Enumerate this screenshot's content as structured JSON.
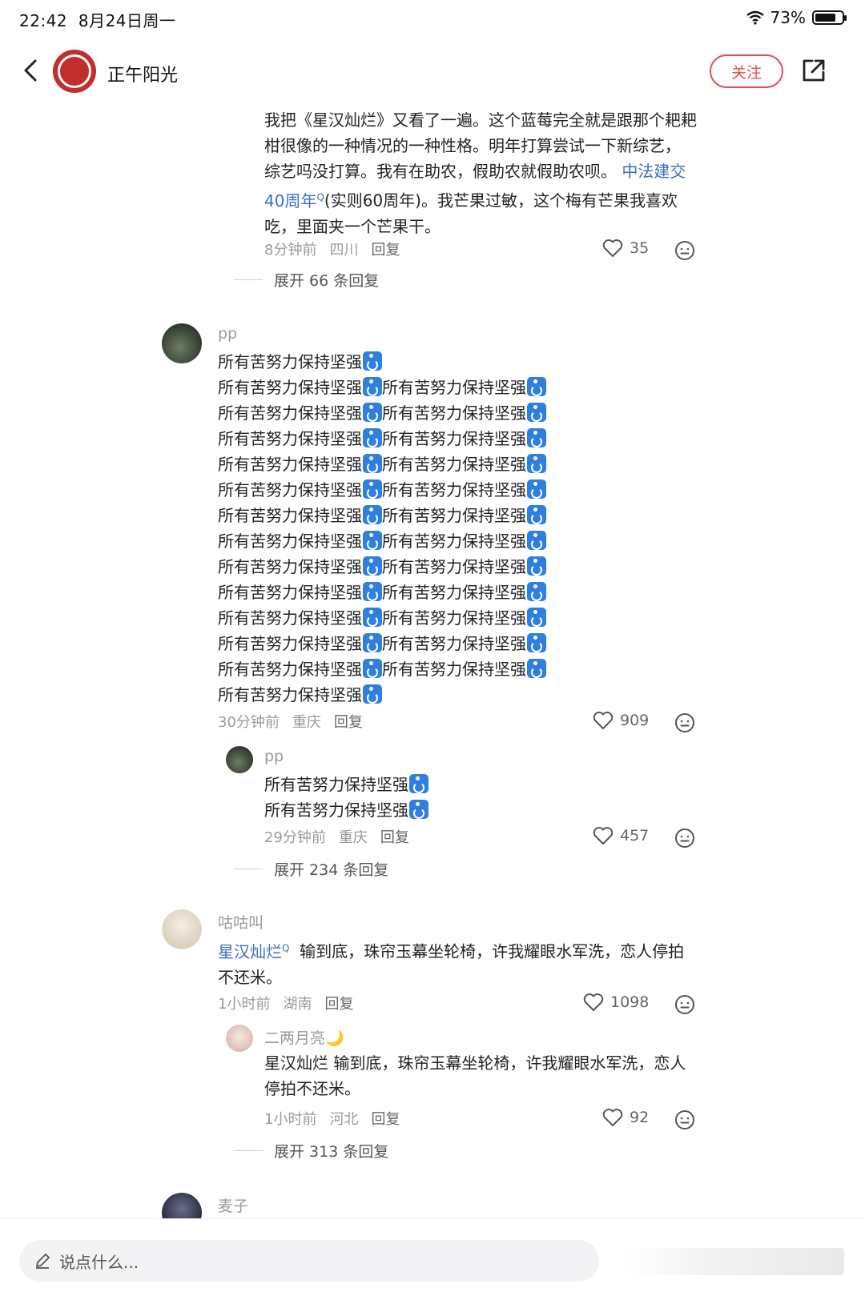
{
  "status": {
    "time": "22:42",
    "date": "8月24日周一",
    "battery": "73%"
  },
  "header": {
    "title": "正午阳光",
    "follow": "关注"
  },
  "post": {
    "lines": [
      "我把《星汉灿烂》又看了一遍。这个蓝莓完全就是跟那个耙耙",
      "柑很像的一种情况的一种性格。明年打算尝试一下新综艺，",
      "综艺吗没打算。我有在助农，假助农就假助农呗。"
    ],
    "link_a": "中法建交",
    "link_b": "40周年",
    "link_b_sup": "Q",
    "line4_rest": "(实则60周年)。我芒果过敏，这个梅有芒果我喜欢",
    "line5": "吃，里面夹一个芒果干。",
    "time": "8分钟前",
    "location": "四川",
    "reply": "回复",
    "likes": "35",
    "expand": "展开 66 条回复"
  },
  "c1": {
    "user": "pp",
    "phrase": "所有苦努力保持坚强",
    "time": "30分钟前",
    "location": "重庆",
    "reply": "回复",
    "likes": "909",
    "sub": {
      "user": "pp",
      "time": "29分钟前",
      "location": "重庆",
      "reply": "回复",
      "likes": "457"
    },
    "expand": "展开 234 条回复"
  },
  "c2": {
    "user": "咕咕叫",
    "link": "星汉灿烂",
    "link_sup": "Q",
    "rest": "输到底，珠帘玉幕坐轮椅，许我耀眼水军洗，恋人停拍",
    "line2": "不还米。",
    "time": "1小时前",
    "location": "湖南",
    "reply": "回复",
    "likes": "1098",
    "sub": {
      "user": "二两月亮🌙",
      "line1": "星汉灿烂  输到底，珠帘玉幕坐轮椅，许我耀眼水军洗，恋人",
      "line2": "停拍不还米。",
      "time": "1小时前",
      "location": "河北",
      "reply": "回复",
      "likes": "92"
    },
    "expand": "展开 313 条回复"
  },
  "c3": {
    "user": "麦子"
  },
  "bottom": {
    "placeholder": "说点什么..."
  },
  "colors": {
    "accent": "#e64a55",
    "link": "#3c6fbf",
    "icon_blue": "#2f7fe0"
  }
}
